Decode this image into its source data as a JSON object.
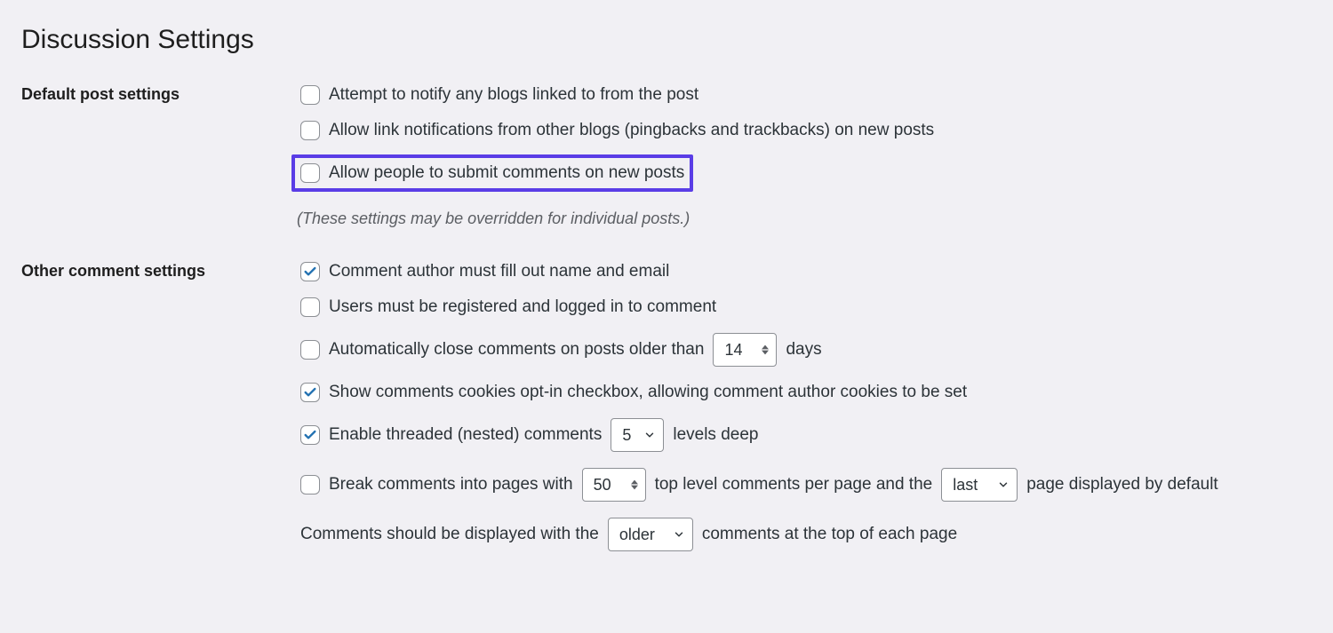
{
  "title": "Discussion Settings",
  "sections": {
    "default_post": {
      "label": "Default post settings",
      "items": [
        {
          "label": "Attempt to notify any blogs linked to from the post",
          "checked": false
        },
        {
          "label": "Allow link notifications from other blogs (pingbacks and trackbacks) on new posts",
          "checked": false
        },
        {
          "label": "Allow people to submit comments on new posts",
          "checked": false,
          "highlight": true
        }
      ],
      "hint": "(These settings may be overridden for individual posts.)"
    },
    "other_comment": {
      "label": "Other comment settings",
      "items": {
        "fill_name_email": {
          "label": "Comment author must fill out name and email",
          "checked": true
        },
        "registered": {
          "label": "Users must be registered and logged in to comment",
          "checked": false
        },
        "auto_close": {
          "label_before": "Automatically close comments on posts older than",
          "value": "14",
          "label_after": "days",
          "checked": false
        },
        "cookies": {
          "label": "Show comments cookies opt-in checkbox, allowing comment author cookies to be set",
          "checked": true
        },
        "threaded": {
          "label_before": "Enable threaded (nested) comments",
          "value": "5",
          "label_after": "levels deep",
          "checked": true
        },
        "break_pages": {
          "label_before": "Break comments into pages with",
          "per_page": "50",
          "label_mid": "top level comments per page and the",
          "default_page": "last",
          "label_after": "page displayed by default",
          "checked": false
        },
        "sort": {
          "label_before": "Comments should be displayed with the",
          "value": "older",
          "label_after": "comments at the top of each page"
        }
      }
    }
  }
}
